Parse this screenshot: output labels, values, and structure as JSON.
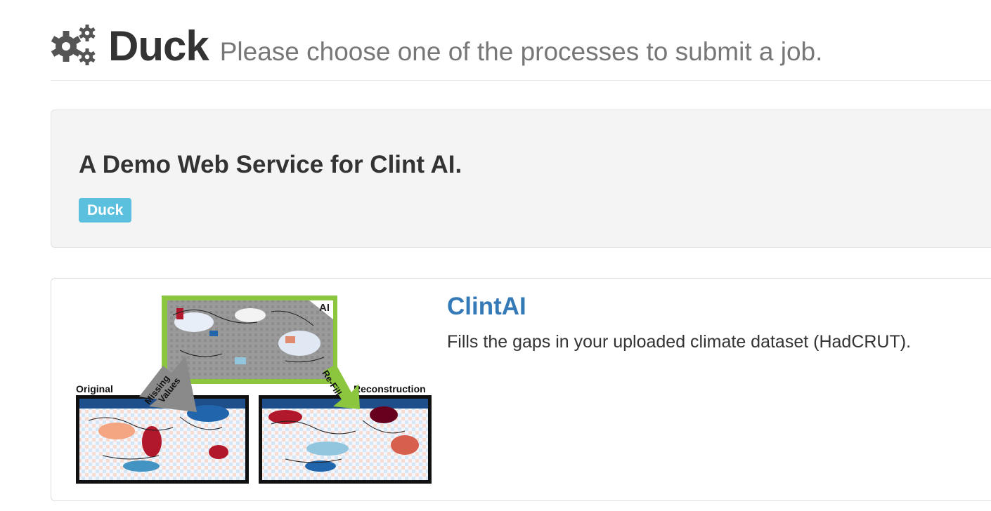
{
  "header": {
    "icon": "gears-icon",
    "title": "Duck",
    "subtitle": "Please choose one of the processes to submit a job."
  },
  "jumbotron": {
    "title": "A Demo Web Service for Clint AI.",
    "tag": "Duck"
  },
  "processes": [
    {
      "title": "ClintAI",
      "description": "Fills the gaps in your uploaded climate dataset (HadCRUT).",
      "figure": {
        "label_ai": "AI",
        "label_original": "Original",
        "label_reconstruction": "Reconstruction",
        "arrow_missing_line1": "Missing",
        "arrow_missing_line2": "Values",
        "arrow_refill": "Re-Fill"
      }
    }
  ],
  "colors": {
    "badge": "#5bc0de",
    "link": "#337ab7",
    "ai_frame": "#8cc63f",
    "arrow_gray": "#8a8a8a",
    "warm": "#b2182b",
    "cold": "#2166ac"
  }
}
